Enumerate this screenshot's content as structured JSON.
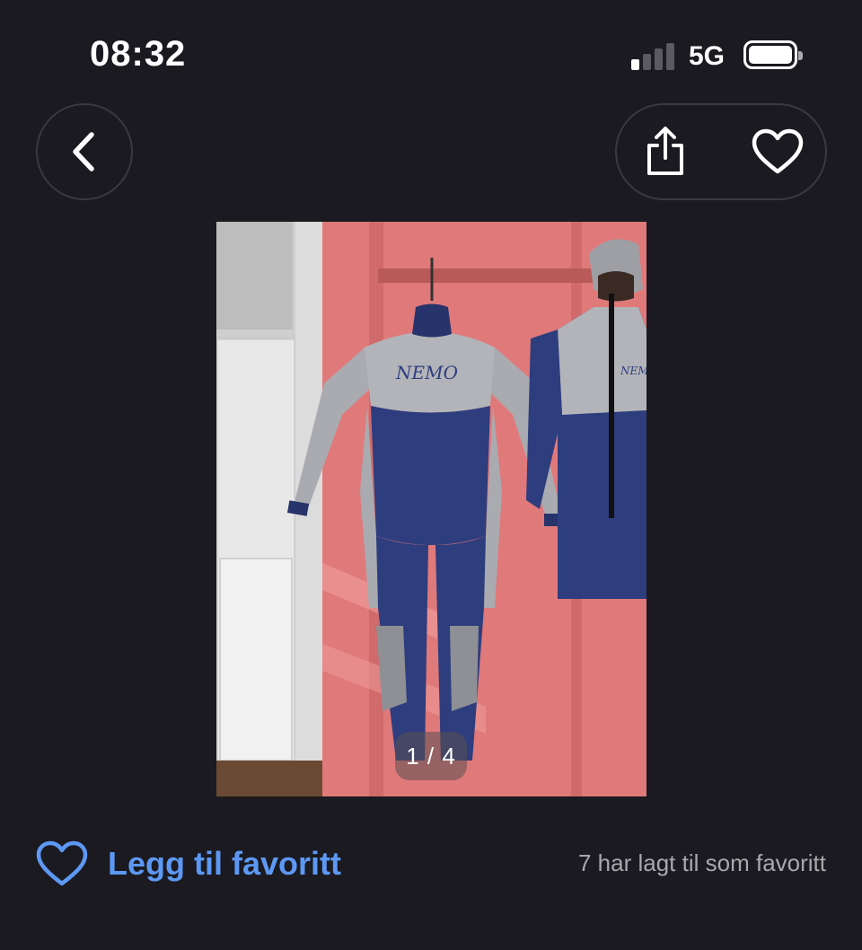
{
  "status_bar": {
    "time": "08:32",
    "network": "5G",
    "signal_bars_active": 1,
    "signal_bars_total": 4
  },
  "nav": {
    "back_icon": "chevron-left-icon",
    "share_icon": "share-icon",
    "favorite_icon": "heart-outline-icon"
  },
  "gallery": {
    "counter": "1 / 4",
    "image_subject": "wetsuit"
  },
  "favorite": {
    "label": "Legg til favoritt",
    "count_text": "7 har lagt til som favoritt"
  },
  "colors": {
    "background": "#1b1a20",
    "accent_blue": "#5d98f4",
    "muted_text": "#a9a8ad"
  }
}
